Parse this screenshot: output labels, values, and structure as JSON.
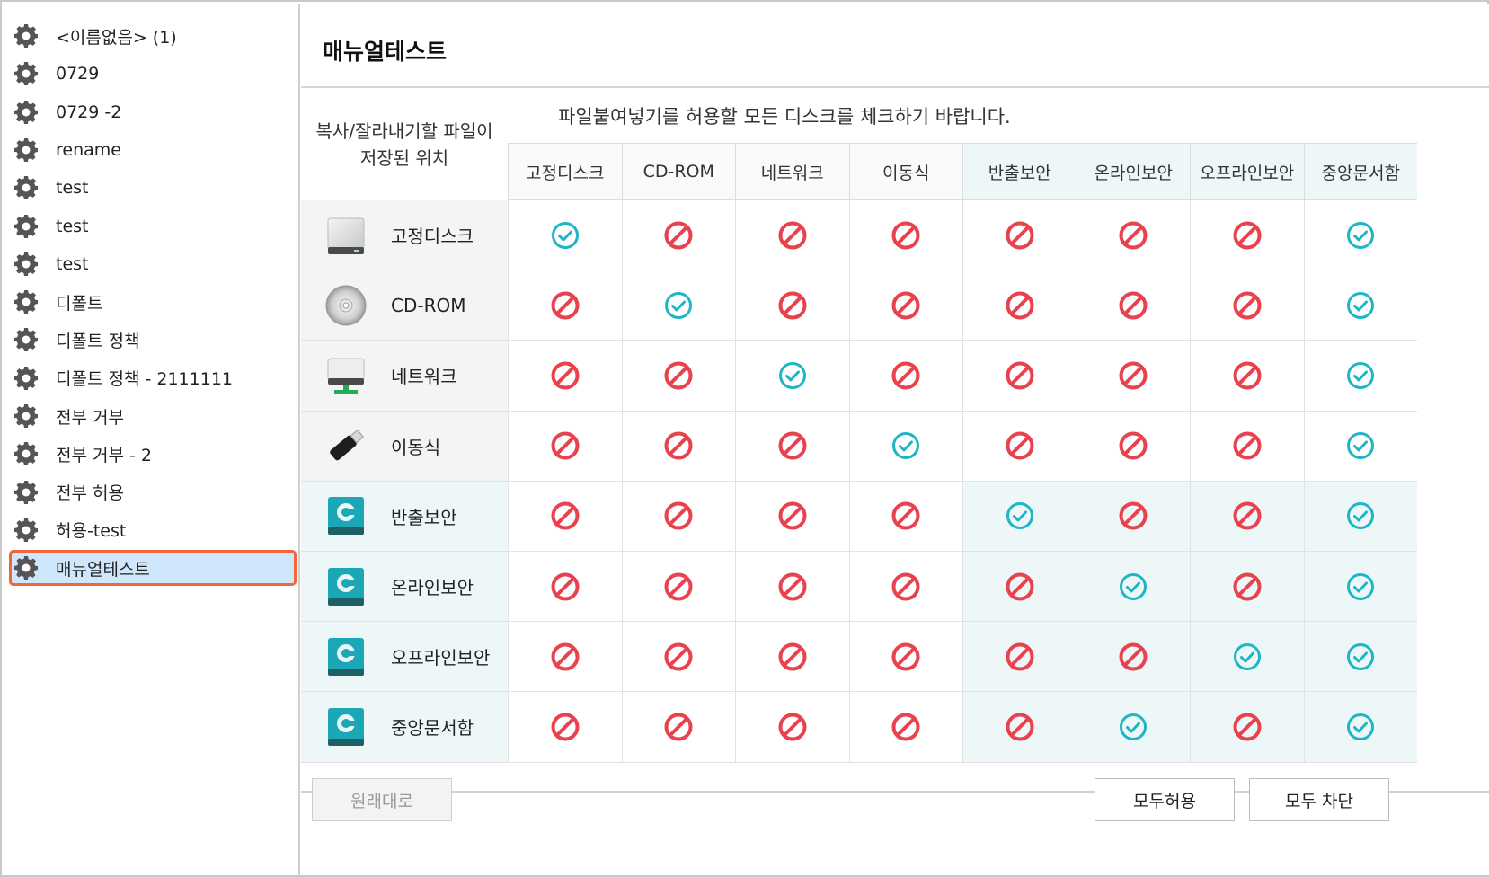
{
  "sidebar": {
    "items": [
      {
        "label": "<이름없음> (1)"
      },
      {
        "label": "0729"
      },
      {
        "label": "0729 -2"
      },
      {
        "label": "rename"
      },
      {
        "label": "test"
      },
      {
        "label": "test"
      },
      {
        "label": "test"
      },
      {
        "label": "디폴트"
      },
      {
        "label": "디폴트 정책"
      },
      {
        "label": "디폴트 정책 - 2111111"
      },
      {
        "label": "전부 거부"
      },
      {
        "label": "전부 거부 - 2"
      },
      {
        "label": "전부 허용"
      },
      {
        "label": "허용-test"
      },
      {
        "label": "매뉴얼테스트",
        "selected": true
      }
    ]
  },
  "main": {
    "title": "매뉴얼테스트",
    "corner_label": "복사/잘라내기할 파일이 저장된 위치",
    "instruction": "파일붙여넣기를 허용할 모든 디스크를 체크하기 바랍니다.",
    "columns": [
      "고정디스크",
      "CD-ROM",
      "네트워크",
      "이동식",
      "반출보안",
      "온라인보안",
      "오프라인보안",
      "중앙문서함"
    ],
    "rows": [
      {
        "label": "고정디스크",
        "icon": "hard-disk-icon",
        "values": [
          "allow",
          "deny",
          "deny",
          "deny",
          "deny",
          "deny",
          "deny",
          "allow"
        ]
      },
      {
        "label": "CD-ROM",
        "icon": "cd-rom-icon",
        "values": [
          "deny",
          "allow",
          "deny",
          "deny",
          "deny",
          "deny",
          "deny",
          "allow"
        ]
      },
      {
        "label": "네트워크",
        "icon": "network-drive-icon",
        "values": [
          "deny",
          "deny",
          "allow",
          "deny",
          "deny",
          "deny",
          "deny",
          "allow"
        ]
      },
      {
        "label": "이동식",
        "icon": "usb-drive-icon",
        "values": [
          "deny",
          "deny",
          "deny",
          "allow",
          "deny",
          "deny",
          "deny",
          "allow"
        ]
      },
      {
        "label": "반출보안",
        "icon": "secure-drive-icon",
        "values": [
          "deny",
          "deny",
          "deny",
          "deny",
          "allow",
          "deny",
          "deny",
          "allow"
        ]
      },
      {
        "label": "온라인보안",
        "icon": "secure-drive-icon",
        "values": [
          "deny",
          "deny",
          "deny",
          "deny",
          "deny",
          "allow",
          "deny",
          "allow"
        ]
      },
      {
        "label": "오프라인보안",
        "icon": "secure-drive-icon",
        "values": [
          "deny",
          "deny",
          "deny",
          "deny",
          "deny",
          "deny",
          "allow",
          "allow"
        ]
      },
      {
        "label": "중앙문서함",
        "icon": "secure-drive-icon",
        "values": [
          "deny",
          "deny",
          "deny",
          "deny",
          "deny",
          "allow",
          "deny",
          "allow"
        ]
      }
    ]
  },
  "buttons": {
    "restore": "원래대로",
    "allow_all": "모두허용",
    "block_all": "모두 차단"
  },
  "colors": {
    "allow": "#1db6c6",
    "deny": "#e8424f",
    "selected_bg": "#cfe6fb",
    "selected_border": "#f0683a",
    "secure_tint": "#eef7f8",
    "header_gray": "#f4f4f4"
  }
}
